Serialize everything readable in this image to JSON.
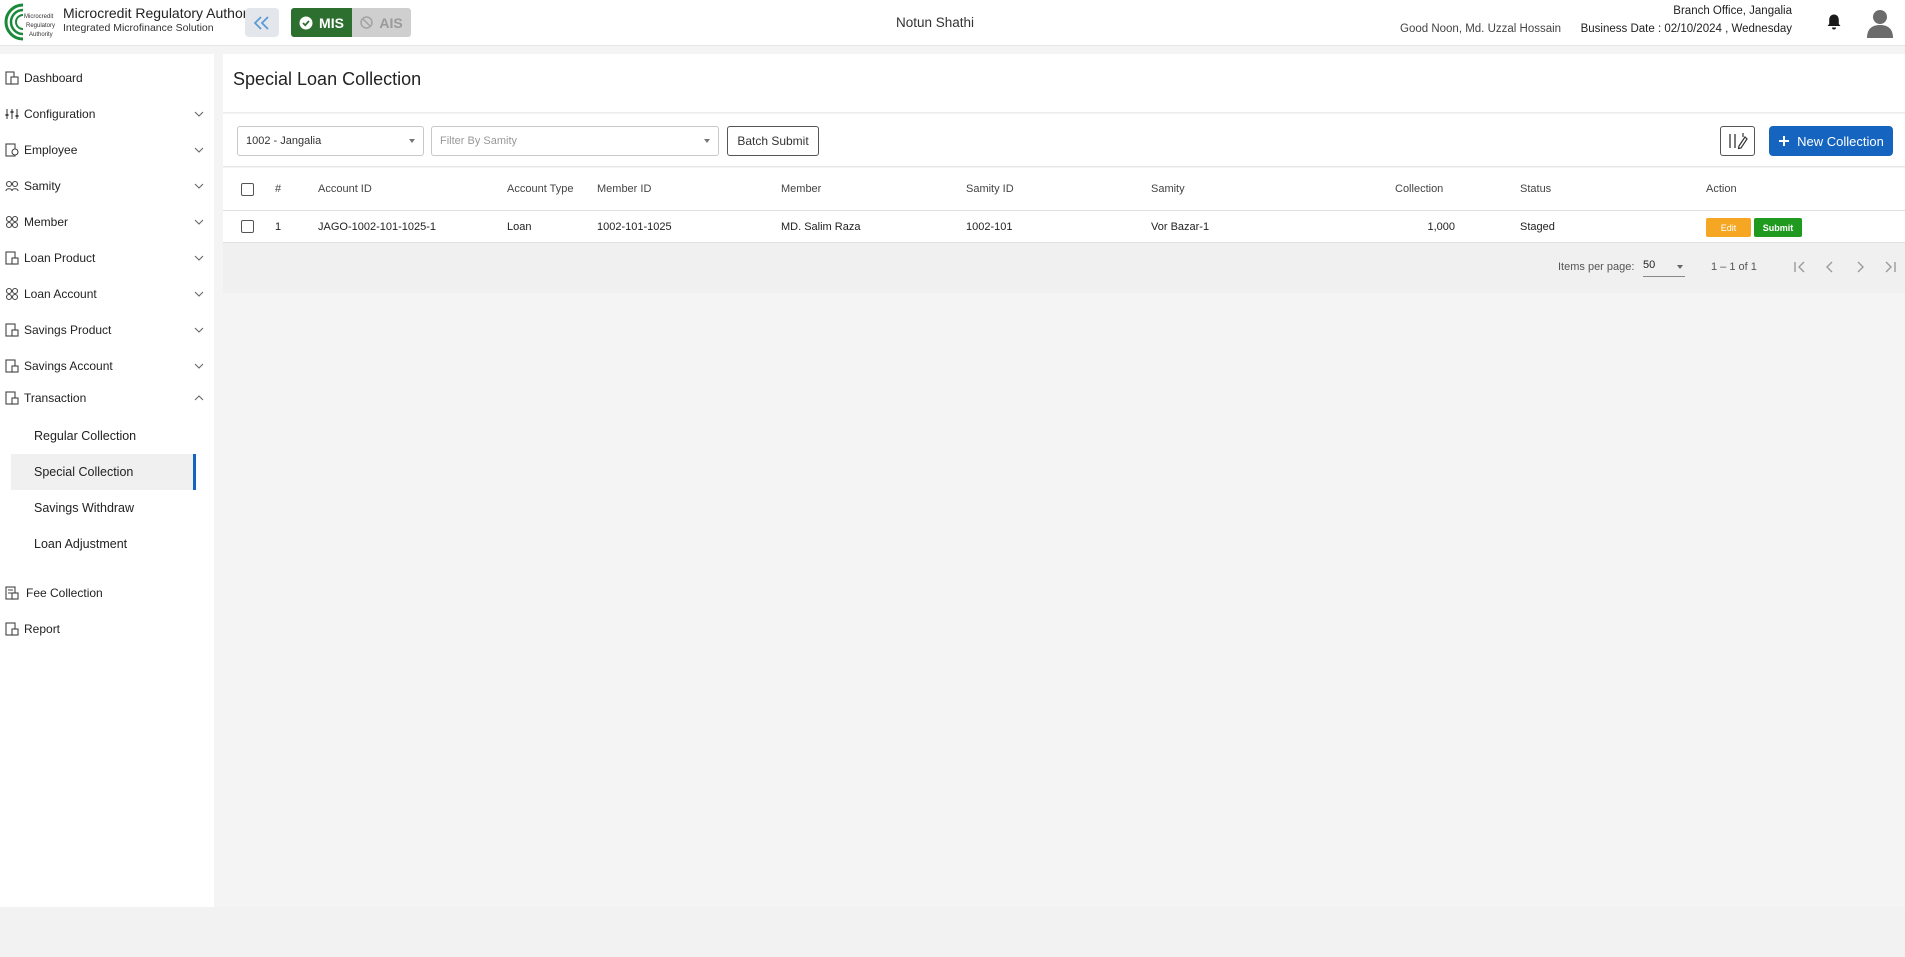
{
  "header": {
    "brand_title": "Microcredit Regulatory Authority",
    "brand_subtitle": "Integrated Microfinance Solution",
    "logo_text": [
      "Microcredit",
      "Regulatory",
      "Authority"
    ],
    "mode_mis": "MIS",
    "mode_ais": "AIS",
    "org_name": "Notun Shathi",
    "greeting": "Good Noon, Md. Uzzal Hossain",
    "branch": "Branch Office, Jangalia",
    "business_date": "Business Date : 02/10/2024 , Wednesday",
    "icons": [
      "double-chevron-left-icon",
      "check-circle-icon",
      "ban-icon",
      "bell-icon",
      "user-avatar-icon"
    ]
  },
  "sidebar": {
    "items": [
      {
        "label": "Dashboard",
        "icon": "dashboard-icon",
        "expandable": false
      },
      {
        "label": "Configuration",
        "icon": "sliders-icon",
        "expandable": true
      },
      {
        "label": "Employee",
        "icon": "employee-icon",
        "expandable": true
      },
      {
        "label": "Samity",
        "icon": "group-icon",
        "expandable": true
      },
      {
        "label": "Member",
        "icon": "member-icon",
        "expandable": true
      },
      {
        "label": "Loan Product",
        "icon": "loan-product-icon",
        "expandable": true
      },
      {
        "label": "Loan Account",
        "icon": "loan-account-icon",
        "expandable": true
      },
      {
        "label": "Savings Product",
        "icon": "savings-product-icon",
        "expandable": true
      },
      {
        "label": "Savings Account",
        "icon": "savings-account-icon",
        "expandable": true
      },
      {
        "label": "Transaction",
        "icon": "transaction-icon",
        "expandable": true,
        "expanded": true
      }
    ],
    "transaction_sub": [
      {
        "label": "Regular Collection"
      },
      {
        "label": "Special Collection",
        "active": true
      },
      {
        "label": "Savings Withdraw"
      },
      {
        "label": "Loan Adjustment"
      }
    ],
    "bottom_items": [
      {
        "label": "Fee Collection",
        "icon": "fee-icon"
      },
      {
        "label": "Report",
        "icon": "report-icon"
      }
    ]
  },
  "page": {
    "title": "Special Loan Collection"
  },
  "filters": {
    "branch_value": "1002 - Jangalia",
    "samity_placeholder": "Filter By Samity",
    "batch_submit_label": "Batch Submit",
    "new_collection_label": "New Collection"
  },
  "table": {
    "columns": [
      "#",
      "Account ID",
      "Account Type",
      "Member ID",
      "Member",
      "Samity ID",
      "Samity",
      "Collection",
      "Status",
      "Action"
    ],
    "rows": [
      {
        "num": "1",
        "account_id": "JAGO-1002-101-1025-1",
        "account_type": "Loan",
        "member_id": "1002-101-1025",
        "member": "MD. Salim Raza",
        "samity_id": "1002-101",
        "samity": "Vor Bazar-1",
        "collection": "1,000",
        "status": "Staged",
        "edit_label": "Edit",
        "submit_label": "Submit"
      }
    ]
  },
  "paginator": {
    "items_per_page_label": "Items per page:",
    "items_per_page": "50",
    "range": "1 – 1 of 1"
  },
  "colors": {
    "primary": "#1565c0",
    "mis_green": "#2d6f2f",
    "edit_orange": "#f5a623",
    "submit_green": "#1f9a1f"
  }
}
